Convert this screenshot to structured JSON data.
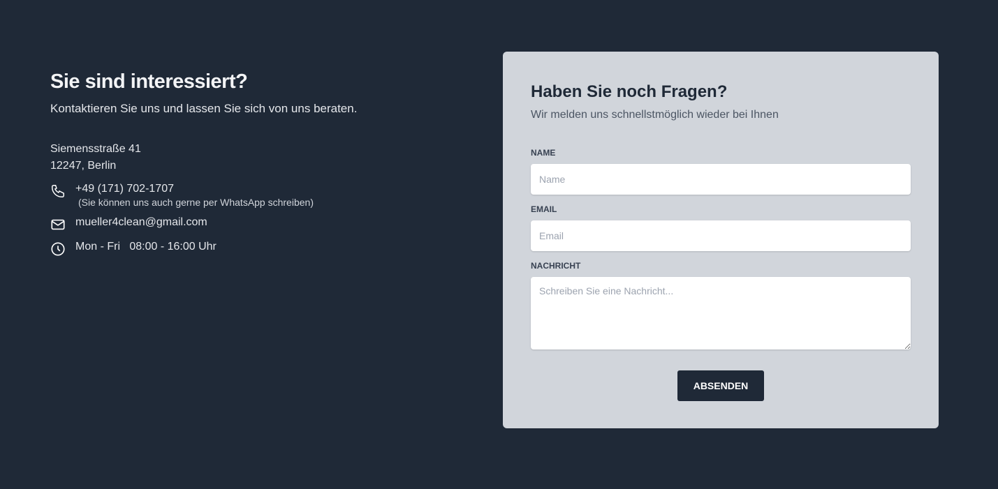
{
  "contact": {
    "title": "Sie sind interessiert?",
    "subtitle": "Kontaktieren Sie uns und lassen Sie sich von uns beraten.",
    "street": "Siemensstraße 41",
    "city": "12247, Berlin",
    "phone": "+49 (171) 702-1707",
    "phone_note": "(Sie können uns auch gerne per WhatsApp schreiben)",
    "email": "mueller4clean@gmail.com",
    "hours": "Mon - Fri   08:00 - 16:00 Uhr"
  },
  "form": {
    "title": "Haben Sie noch Fragen?",
    "subtitle": "Wir melden uns schnellstmöglich wieder bei Ihnen",
    "name_label": "NAME",
    "name_placeholder": "Name",
    "email_label": "EMAIL",
    "email_placeholder": "Email",
    "message_label": "NACHRICHT",
    "message_placeholder": "Schreiben Sie eine Nachricht...",
    "submit_label": "ABSENDEN"
  }
}
